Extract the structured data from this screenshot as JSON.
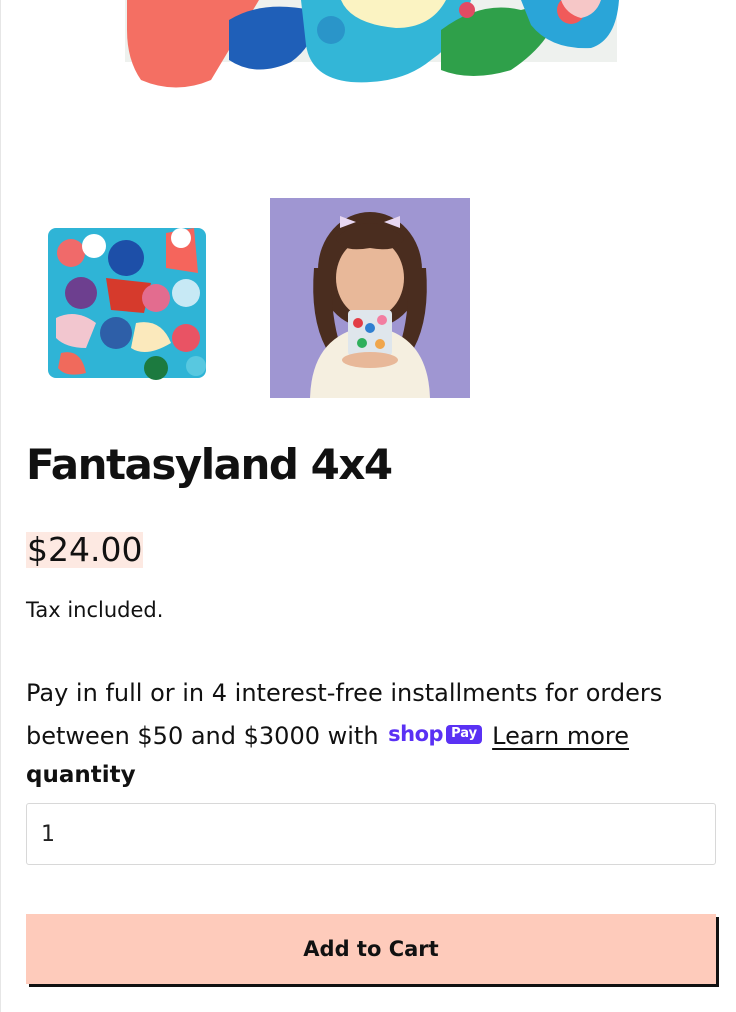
{
  "product": {
    "title": "Fantasyland 4x4",
    "price": "$24.00",
    "tax_note": "Tax included."
  },
  "installments": {
    "text": "Pay in full or in 4 interest-free installments for orders between $50 and $3000 with",
    "brand_word": "shop",
    "brand_badge": "Pay",
    "learn_more": "Learn more"
  },
  "quantity": {
    "label": "quantity",
    "value": "1"
  },
  "cart": {
    "add_label": "Add to Cart"
  },
  "colors": {
    "accent_button": "#fecbbb",
    "price_highlight": "#fde9e2",
    "shop_pay_purple": "#5a31f4",
    "thumb_background_purple": "#9f96d2"
  },
  "images": {
    "hero": "gummy-candy-hero-image",
    "thumbnails": [
      "gummy-candy-box-thumbnail",
      "girl-holding-candy-box-thumbnail"
    ]
  }
}
